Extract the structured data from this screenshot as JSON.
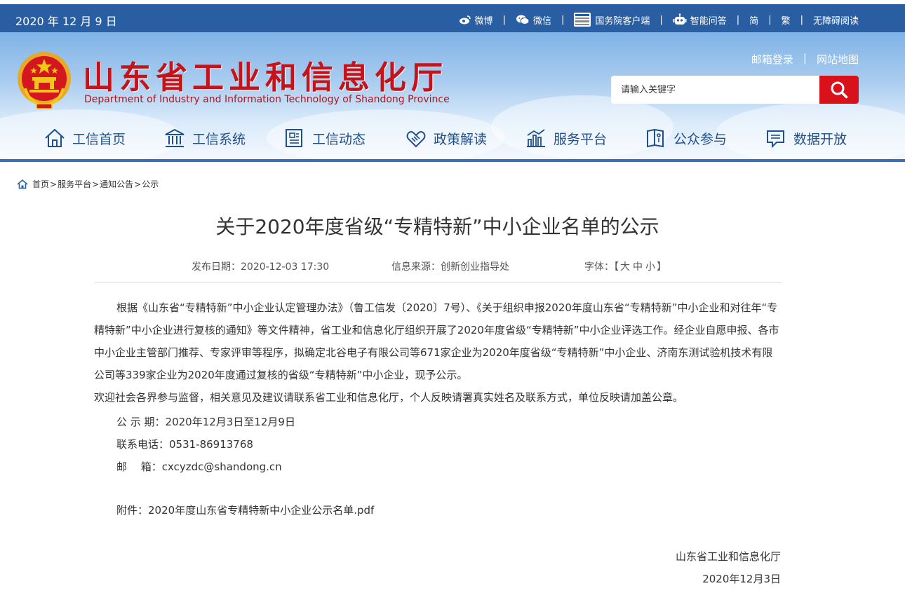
{
  "topbar": {
    "date": "2020 年 12 月 9 日",
    "links": {
      "weibo": "微博",
      "weixin": "微信",
      "gov_client": "国务院客户端",
      "ai_qa": "智能问答",
      "simplified": "简",
      "traditional": "繁",
      "accessibility": "无障碍阅读"
    },
    "separator": "|"
  },
  "header": {
    "title": "山东省工业和信息化厅",
    "subtitle": "Department of Industry and Information Technology of Shandong Province",
    "mail_login": "邮箱登录",
    "site_map": "网站地图",
    "search_placeholder": "请输入关键字"
  },
  "nav": {
    "items": [
      {
        "label": "工信首页",
        "icon": "home-icon"
      },
      {
        "label": "工信系统",
        "icon": "building-icon"
      },
      {
        "label": "工信动态",
        "icon": "news-icon"
      },
      {
        "label": "政策解读",
        "icon": "handshake-icon"
      },
      {
        "label": "服务平台",
        "icon": "chart-icon"
      },
      {
        "label": "公众参与",
        "icon": "book-icon"
      },
      {
        "label": "数据开放",
        "icon": "message-icon"
      }
    ]
  },
  "breadcrumb": {
    "items": [
      "首页",
      "服务平台",
      "通知公告",
      "公示"
    ],
    "sep": ">"
  },
  "article": {
    "title": "关于2020年度省级“专精特新”中小企业名单的公示",
    "publish_date": "发布日期：2020-12-03 17:30",
    "source": "信息来源：创新创业指导处",
    "font_label": "字体：",
    "font_bracket_open": "【",
    "font_big": "大",
    "font_mid": "中",
    "font_small": "小",
    "font_bracket_close": "】",
    "paragraph1": "根据《山东省“专精特新”中小企业认定管理办法》（鲁工信发〔2020〕7号）、《关于组织申报2020年度山东省“专精特新”中小企业和对往年“专精特新”中小企业进行复核的通知》等文件精神，省工业和信息化厅组织开展了2020年度省级“专精特新”中小企业评选工作。经企业自愿申报、各市中小企业主管部门推荐、专家评审等程序，拟确定北谷电子有限公司等671家企业为2020年度省级“专精特新”中小企业、济南东测试验机技术有限公司等339家企业为2020年度通过复核的省级“专精特新”中小企业，现予公示。",
    "paragraph2": "欢迎社会各界参与监督，相关意见及建议请联系省工业和信息化厅，个人反映请署真实姓名及联系方式，单位反映请加盖公章。",
    "period": "公 示 期：2020年12月3日至12月9日",
    "phone": "联系电话：0531-86913768",
    "email_label": "邮　 箱：",
    "email": "cxcyzdc@shandong.cn",
    "attachment_label": "附件：",
    "attachment": "2020年度山东省专精特新中小企业公示名单.pdf",
    "signature": "山东省工业和信息化厅",
    "sign_date": "2020年12月3日"
  },
  "colors": {
    "topbar": "#2a5ea2",
    "title_red": "#c4131b",
    "search_button": "#d9111b",
    "nav_text": "#1f4f8c"
  }
}
